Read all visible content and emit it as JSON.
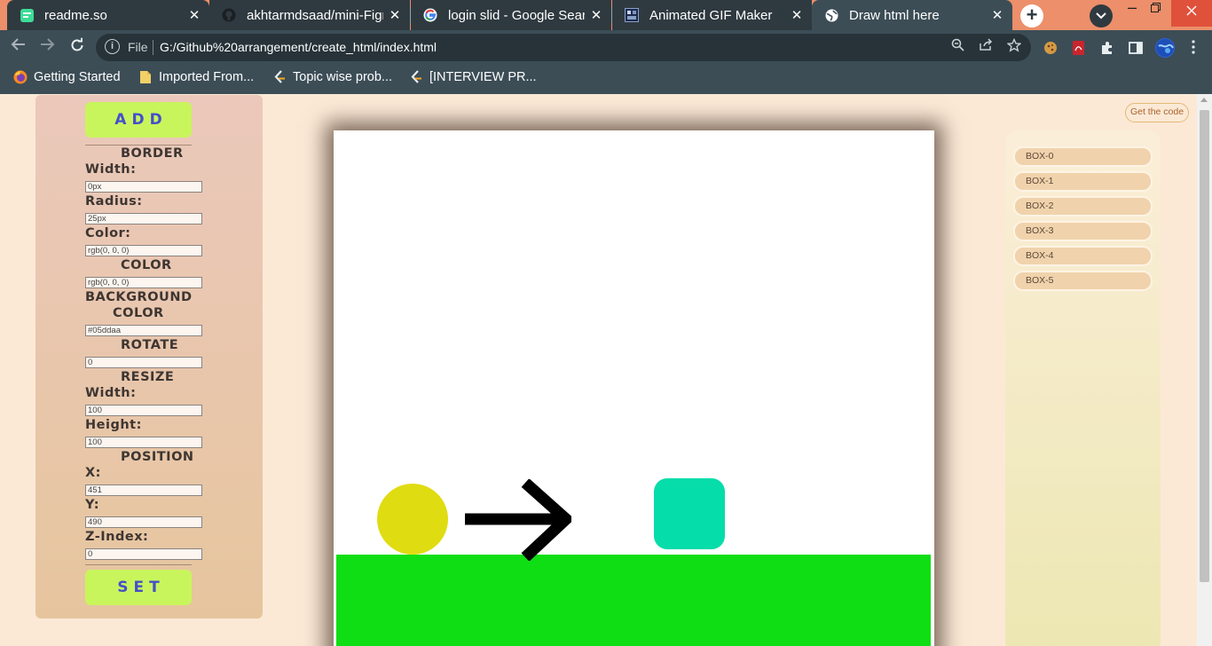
{
  "browser": {
    "tabs": [
      {
        "title": "readme.so",
        "icon": "readme-so-icon",
        "active": false
      },
      {
        "title": "akhtarmdsaad/mini-Figm",
        "icon": "github-icon",
        "active": false
      },
      {
        "title": "login slid - Google Searc",
        "icon": "google-icon",
        "active": false
      },
      {
        "title": "Animated GIF Maker",
        "icon": "gif-maker-icon",
        "active": false
      },
      {
        "title": "Draw html here",
        "icon": "globe-icon",
        "active": true
      }
    ],
    "close_glyph": "✕",
    "new_tab_glyph": "+",
    "address": {
      "scheme_label": "File",
      "url": "G:/Github%20arrangement/create_html/index.html"
    },
    "bookmarks": [
      {
        "label": "Getting Started",
        "icon": "firefox-icon"
      },
      {
        "label": "Imported From...",
        "icon": "folder-icon"
      },
      {
        "label": "Topic wise prob...",
        "icon": "leetcode-icon"
      },
      {
        "label": "[INTERVIEW PR...",
        "icon": "leetcode-icon"
      }
    ],
    "colors": {
      "tabbar": "#ec8f6a",
      "toolbar": "#3c4d56"
    }
  },
  "controls": {
    "add_label": "ADD",
    "set_label": "SET",
    "sections": {
      "border": "BORDER",
      "color": "COLOR",
      "background_line1": "BACKGROUND",
      "background_line2": "COLOR",
      "rotate": "ROTATE",
      "resize": "RESIZE",
      "position": "POSITION"
    },
    "labels": {
      "border_width": "Width:",
      "border_radius": "Radius:",
      "border_color": "Color:",
      "resize_width": "Width:",
      "resize_height": "Height:",
      "x": "X:",
      "y": "Y:",
      "z_index": "Z-Index:"
    },
    "values": {
      "border_width": "0px",
      "border_radius": "25px",
      "border_color": "rgb(0, 0, 0)",
      "color": "rgb(0, 0, 0)",
      "background_color": "#05ddaa",
      "rotate": "0",
      "resize_width": "100",
      "resize_height": "100",
      "x": "451",
      "y": "490",
      "z_index": "0"
    }
  },
  "canvas": {
    "colors": {
      "ground": "#10de14",
      "ball": "#e0dc12",
      "box": "#05ddaa",
      "arrow": "#000000"
    }
  },
  "get_code_label": "Get the code",
  "layers": [
    "BOX-0",
    "BOX-1",
    "BOX-2",
    "BOX-3",
    "BOX-4",
    "BOX-5"
  ]
}
